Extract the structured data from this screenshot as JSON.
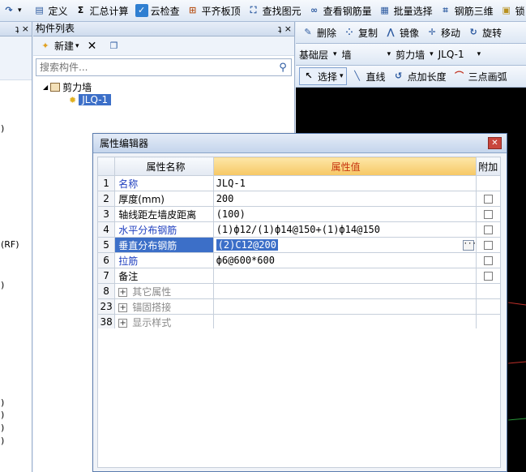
{
  "toolbar": {
    "items": [
      {
        "label": "定义",
        "icon": "define-icon"
      },
      {
        "label": "汇总计算",
        "icon": "sigma-icon"
      },
      {
        "label": "云检查",
        "icon": "cloud-check-icon"
      },
      {
        "label": "平齐板顶",
        "icon": "align-slab-icon"
      },
      {
        "label": "查找图元",
        "icon": "binoculars-icon"
      },
      {
        "label": "查看钢筋量",
        "icon": "glasses-icon"
      },
      {
        "label": "批量选择",
        "icon": "batch-select-icon"
      },
      {
        "label": "钢筋三维",
        "icon": "rebar-3d-icon"
      },
      {
        "label": "锁",
        "icon": "lock-icon"
      }
    ]
  },
  "left_panel": {
    "pin": "ʇ ×",
    "row_marks": [
      ")",
      "(RF)",
      ")",
      ")",
      ")",
      ")",
      ")"
    ]
  },
  "component_panel": {
    "title": "构件列表",
    "pin": "ʇ ×",
    "new_label": "新建",
    "search_placeholder": "搜索构件...",
    "tree": {
      "parent": "剪力墙",
      "child": "JLQ-1"
    }
  },
  "right_panel": {
    "edit_tools": [
      "删除",
      "复制",
      "镜像",
      "移动",
      "旋转"
    ],
    "dropdowns": [
      "基础层",
      "墙",
      "剪力墙",
      "JLQ-1"
    ],
    "draw_tools": [
      "选择",
      "直线",
      "点加长度",
      "三点画弧"
    ]
  },
  "dialog": {
    "title": "属性编辑器",
    "columns": [
      "属性名称",
      "属性值",
      "附加"
    ],
    "rows": [
      {
        "num": "1",
        "name": "名称",
        "value": "JLQ-1",
        "style": "blue",
        "checkbox": false
      },
      {
        "num": "2",
        "name": "厚度(mm)",
        "value": "200",
        "style": "normal",
        "checkbox": true
      },
      {
        "num": "3",
        "name": "轴线距左墙皮距离",
        "value": "(100)",
        "style": "normal",
        "checkbox": true
      },
      {
        "num": "4",
        "name": "水平分布钢筋",
        "value": "(1)ф12/(1)ф14@150+(1)ф14@150",
        "style": "blue",
        "checkbox": true
      },
      {
        "num": "5",
        "name": "垂直分布钢筋",
        "value": "(2)C12@200",
        "style": "selected",
        "checkbox": true
      },
      {
        "num": "6",
        "name": "拉筋",
        "value": "ф6@600*600",
        "style": "blue",
        "checkbox": true
      },
      {
        "num": "7",
        "name": "备注",
        "value": "",
        "style": "normal",
        "checkbox": true
      },
      {
        "num": "8",
        "name": "其它属性",
        "value": "",
        "style": "group",
        "checkbox": false
      },
      {
        "num": "23",
        "name": "锚固搭接",
        "value": "",
        "style": "group",
        "checkbox": false
      },
      {
        "num": "38",
        "name": "显示样式",
        "value": "",
        "style": "group",
        "checkbox": false
      }
    ]
  }
}
